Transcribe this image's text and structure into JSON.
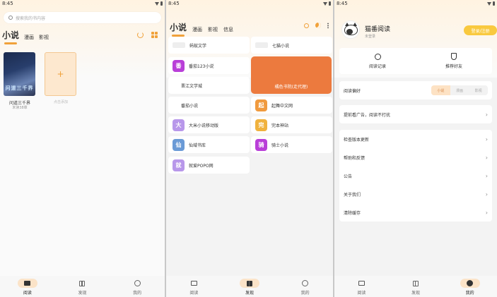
{
  "status": {
    "time": "8:45"
  },
  "bookshelf": {
    "search_placeholder": "搜索我的书内容",
    "tabs": [
      "小说",
      "漫画",
      "影视"
    ],
    "book": {
      "cover_text": "问道三千界",
      "title": "问道三千界",
      "subtitle": "未读38章"
    },
    "add_label": "点击添加",
    "add_symbol": "+"
  },
  "discover": {
    "tabs": [
      "小说",
      "漫画",
      "影视",
      "信息"
    ],
    "left_sites": [
      {
        "name": "蚂蚁文学",
        "icon": "",
        "color": "#eeeeee",
        "icon_type": "logo"
      },
      {
        "name": "番茄123小说",
        "icon": "番",
        "color": "#b93fd8"
      },
      {
        "name": "晋江文学城",
        "icon": "",
        "color": "",
        "icon_type": "empty"
      },
      {
        "name": "番茄小说",
        "icon": "",
        "color": "",
        "icon_type": "empty"
      },
      {
        "name": "大米小说移动版",
        "icon": "大",
        "color": "#b897ea"
      },
      {
        "name": "仙域书库",
        "icon": "仙",
        "color": "#6a9ad6"
      },
      {
        "name": "就爱POPO网",
        "icon": "就",
        "color": "#b897ea"
      }
    ],
    "right_sites": [
      {
        "name": "七猫小说",
        "icon": "",
        "color": "#eeeeee",
        "icon_type": "logo"
      },
      {
        "name": "起舞中文网",
        "icon": "起",
        "color": "#f09a3e"
      },
      {
        "name": "完本神站",
        "icon": "完",
        "color": "#f0b23e"
      },
      {
        "name": "骑士小说",
        "icon": "骑",
        "color": "#b93fd8"
      }
    ],
    "featured": {
      "label": "橘色书院(走代理)",
      "color": "#ec7a3e"
    }
  },
  "profile": {
    "app_name": "猫番阅读",
    "app_sub": "未登录",
    "login_button": "登录/注册",
    "quick": [
      {
        "label": "阅读记录",
        "icon": "clock-icon"
      },
      {
        "label": "推荐好友",
        "icon": "shield-icon"
      }
    ],
    "preference": {
      "label": "阅读偏好",
      "options": [
        "小说",
        "漫画",
        "影视"
      ],
      "selected": 0
    },
    "ad_row": "提前看广告，阅读不打扰",
    "menu": [
      "检查版本更新",
      "帮助和反馈",
      "公告",
      "关于我们",
      "清除缓存"
    ]
  },
  "nav": {
    "labels": [
      "阅读",
      "发现",
      "我的"
    ]
  },
  "chevron": "›"
}
